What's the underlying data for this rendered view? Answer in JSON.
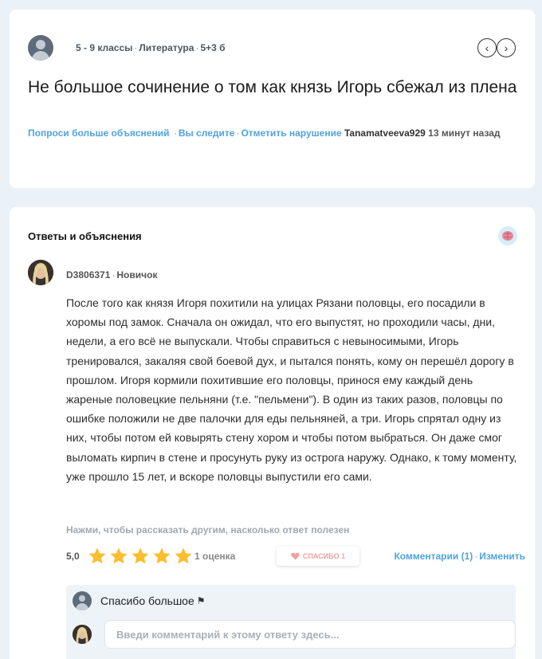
{
  "question": {
    "grade": "5 - 9 классы",
    "subject": "Литература",
    "points": "5+3 б",
    "title": "Не большое сочинение о том как князь Игорь сбежал из плена",
    "links": {
      "ask_more": "Попроси больше объяснений",
      "following": "Вы следите",
      "report": "Отметить нарушение",
      "author": "Tanamatveeva929",
      "ago": "13 минут назад"
    }
  },
  "answers": {
    "section_title": "Ответы и объяснения",
    "answer": {
      "author": "D3806371",
      "rank": "Новичок",
      "text": "После того как князя Игоря похитили на улицах Рязани половцы, его посадили в хоромы под замок. Сначала он ожидал, что его выпустят, но проходили часы, дни, недели, а его всё не выпускали. Чтобы справиться с невыносимыми, Игорь тренировался, закаляя свой боевой дух, и пытался понять, кому он перешёл дорогу в прошлом. Игоря кормили похитившие его половцы, принося ему каждый день жареные половецкие пельняни (т.е. \"пельмени\"). В один из таких разов, половцы по ошибке положили не две палочки для еды пельняней, а три. Игорь спрятал одну из них, чтобы потом ей ковырять стену хором и чтобы потом выбраться. Он даже смог выломать кирпич в стене и просунуть руку из острога наружу. Однако, к тому моменту, уже прошло 15 лет, и вскоре половцы выпустили его сами.",
      "helpful_hint": "Нажми, чтобы рассказать другим, насколько ответ полезен",
      "rating": "5,0",
      "stars_filled": 5,
      "stars_total": 5,
      "rating_count": "1 оценка",
      "thanks_label": "СПАСИБО 1",
      "comments_link": "Комментарии (1)",
      "edit_link": "Изменить"
    },
    "comments": [
      {
        "text": "Спасибо большое"
      }
    ],
    "comment_input_placeholder": "Введи комментарий к этому ответу здесь..."
  },
  "colors": {
    "link": "#4fa3e0",
    "star": "#fbbe2e",
    "heart": "#f2a0a3",
    "background": "#ebf2f7"
  },
  "icons": [
    "user-avatar",
    "chevron-left-icon",
    "chevron-right-icon",
    "brain-icon",
    "star-icon",
    "heart-icon",
    "flag-icon"
  ]
}
